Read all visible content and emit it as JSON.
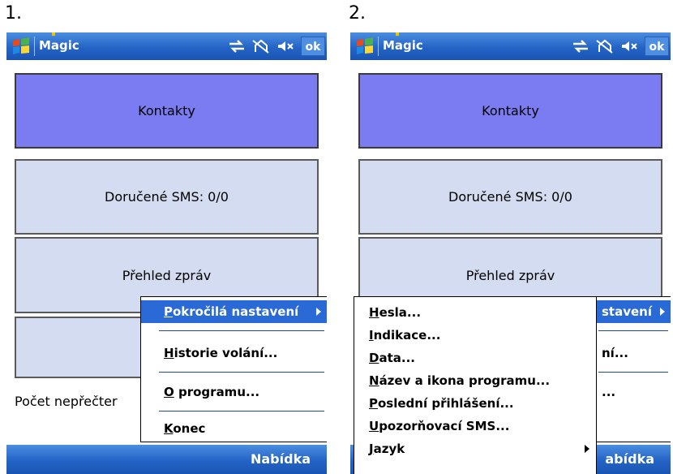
{
  "panels": [
    {
      "step": "1.",
      "title": "Magic",
      "ok": "ok",
      "buttons": [
        "Kontakty",
        "Doručené SMS: 0/0",
        "Přehled zpráv"
      ],
      "unread_text": "Počet nepřečter",
      "softkey": "Nabídka",
      "menu": [
        {
          "u": "P",
          "rest": "okročilá nastavení"
        },
        {
          "u": "H",
          "rest": "istorie volání..."
        },
        {
          "u": "O",
          "rest": " programu..."
        },
        {
          "u": "K",
          "rest": "onec"
        }
      ]
    },
    {
      "step": "2.",
      "title": "Magic",
      "ok": "ok",
      "buttons": [
        "Kontakty",
        "Doručené SMS: 0/0",
        "Přehled zpráv"
      ],
      "softkey": "abídka",
      "parent_menu": [
        "stavení",
        "ní...",
        "..."
      ],
      "submenu": [
        {
          "u": "H",
          "rest": "esla..."
        },
        {
          "u": "I",
          "rest": "ndikace..."
        },
        {
          "u": "D",
          "rest": "ata..."
        },
        {
          "u": "N",
          "rest": "ázev a ikona programu..."
        },
        {
          "u": "P",
          "rest": "oslední přihlášení..."
        },
        {
          "u": "U",
          "rest": "pozorňovací SMS..."
        },
        {
          "u": "J",
          "rest": "azyk"
        }
      ]
    }
  ]
}
